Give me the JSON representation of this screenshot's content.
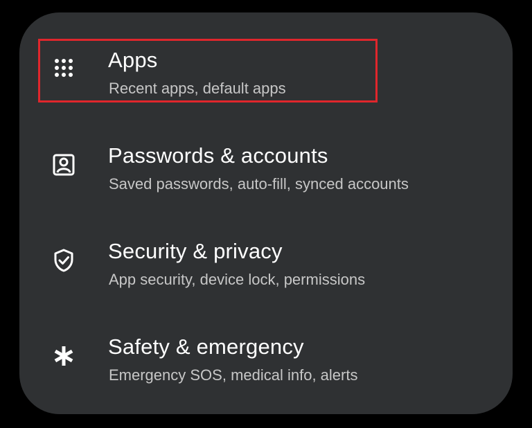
{
  "settings": {
    "items": [
      {
        "title": "Apps",
        "subtitle": "Recent apps, default apps",
        "icon": "apps-grid-icon"
      },
      {
        "title": "Passwords & accounts",
        "subtitle": "Saved passwords, auto-fill, synced accounts",
        "icon": "account-box-icon"
      },
      {
        "title": "Security & privacy",
        "subtitle": "App security, device lock, permissions",
        "icon": "shield-check-icon"
      },
      {
        "title": "Safety & emergency",
        "subtitle": "Emergency SOS, medical info, alerts",
        "icon": "asterisk-icon"
      }
    ]
  },
  "colors": {
    "panel_background": "#2f3133",
    "title_text": "#ffffff",
    "subtitle_text": "#c7c7c7",
    "highlight_border": "#e0262c"
  }
}
